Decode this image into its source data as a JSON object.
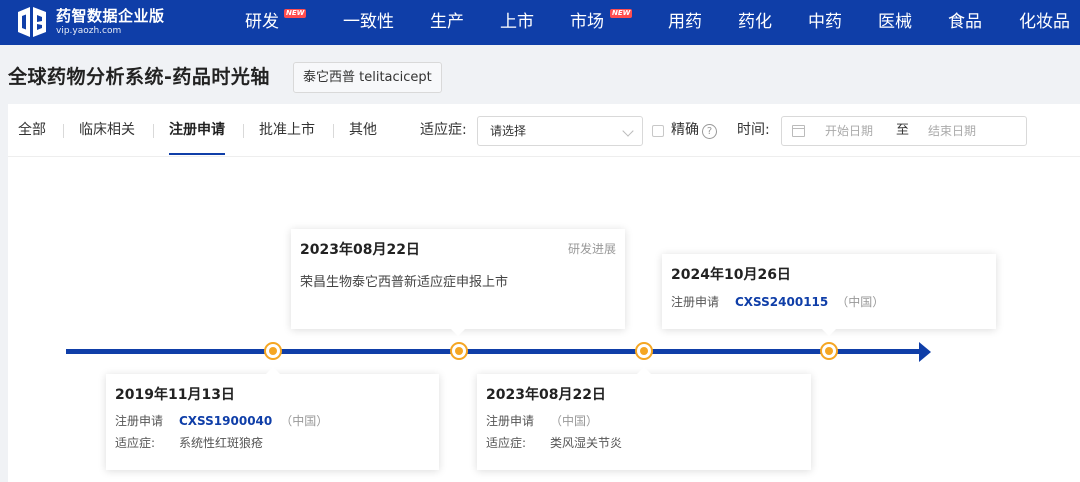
{
  "brand": {
    "name": "药智数据企业版",
    "url": "vip.yaozh.com"
  },
  "nav": [
    {
      "label": "研发",
      "badge": "NEW"
    },
    {
      "label": "一致性",
      "badge": ""
    },
    {
      "label": "生产",
      "badge": ""
    },
    {
      "label": "上市",
      "badge": ""
    },
    {
      "label": "市场",
      "badge": "NEW"
    },
    {
      "label": "用药",
      "badge": ""
    },
    {
      "label": "药化",
      "badge": ""
    },
    {
      "label": "中药",
      "badge": ""
    },
    {
      "label": "医械",
      "badge": ""
    },
    {
      "label": "食品",
      "badge": ""
    },
    {
      "label": "化妆品",
      "badge": ""
    }
  ],
  "page": {
    "title": "全球药物分析系统-药品时光轴",
    "drug_tag": "泰它西普 telitacicept"
  },
  "tabs": [
    {
      "label": "全部",
      "active": false
    },
    {
      "label": "临床相关",
      "active": false
    },
    {
      "label": "注册申请",
      "active": true
    },
    {
      "label": "批准上市",
      "active": false
    },
    {
      "label": "其他",
      "active": false
    }
  ],
  "filters": {
    "indication_label": "适应症:",
    "indication_placeholder": "请选择",
    "exact_label": "精确",
    "exact_checked": false,
    "help": "?",
    "time_label": "时间:",
    "start_placeholder": "开始日期",
    "range_sep": "至",
    "end_placeholder": "结束日期"
  },
  "timeline": {
    "accent_color": "#0f3ea8",
    "dot_color": "#f5a623",
    "events": [
      {
        "date": "2019年11月13日",
        "rows": [
          {
            "key": "注册申请",
            "code": "CXSS1900040",
            "country": "（中国）"
          },
          {
            "key": "适应症:",
            "value": "系统性红斑狼疮"
          }
        ]
      },
      {
        "date": "2023年08月22日",
        "category": "研发进展",
        "description": "荣昌生物泰它西普新适应症申报上市"
      },
      {
        "date": "2023年08月22日",
        "rows": [
          {
            "key": "注册申请",
            "code": "",
            "country": "（中国）"
          },
          {
            "key": "适应症:",
            "value": "类风湿关节炎"
          }
        ]
      },
      {
        "date": "2024年10月26日",
        "rows": [
          {
            "key": "注册申请",
            "code": "CXSS2400115",
            "country": "（中国）"
          }
        ]
      }
    ]
  }
}
